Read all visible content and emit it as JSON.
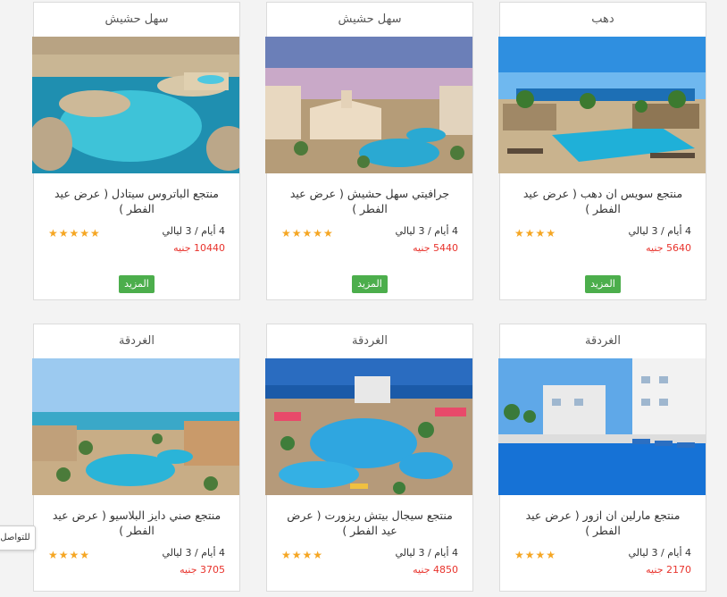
{
  "cards": [
    {
      "location": "دهب",
      "name": "منتجع سويس ان دهب ( عرض عيد الفطر )",
      "duration": "4 أيام / 3 ليالي",
      "price": "5640 جنيه",
      "stars": "★★★★",
      "more": "المزيد"
    },
    {
      "location": "سهل حشيش",
      "name": "جرافيتي سهل حشيش ( عرض عيد الفطر )",
      "duration": "4 أيام / 3 ليالي",
      "price": "5440 جنيه",
      "stars": "★★★★★",
      "more": "المزيد"
    },
    {
      "location": "سهل حشيش",
      "name": "منتجع الباتروس سيتادل ( عرض عيد الفطر )",
      "duration": "4 أيام / 3 ليالي",
      "price": "10440 جنيه",
      "stars": "★★★★★",
      "more": "المزيد"
    },
    {
      "location": "الغردقة",
      "name": "منتجع مارلين ان ازور ( عرض عيد الفطر )",
      "duration": "4 أيام / 3 ليالي",
      "price": "2170 جنيه",
      "stars": "★★★★"
    },
    {
      "location": "الغردقة",
      "name": "منتجع سيجال بيتش ريزورت ( عرض عيد الفطر )",
      "duration": "4 أيام / 3 ليالي",
      "price": "4850 جنيه",
      "stars": "★★★★"
    },
    {
      "location": "الغردقة",
      "name": "منتجع صني دايز البلاسيو ( عرض عيد الفطر )",
      "duration": "4 أيام / 3 ليالي",
      "price": "3705 جنيه",
      "stars": "★★★★"
    }
  ],
  "contact_label": "للتواصل"
}
